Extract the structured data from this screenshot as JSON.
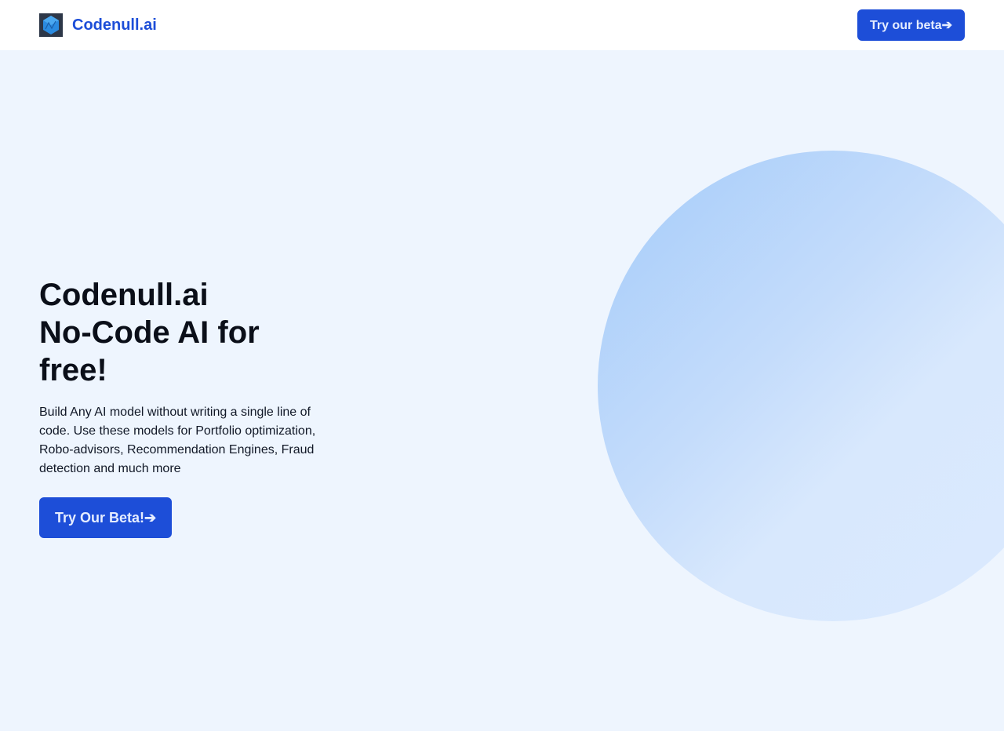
{
  "navbar": {
    "logo_icon": "cube-logo-icon",
    "brand_name": "Codenull.ai",
    "cta_label": "Try our beta➔"
  },
  "hero": {
    "title_lines": [
      "Codenull.ai",
      "No-Code AI for",
      "free!"
    ],
    "description": "Build Any AI model without writing a single line of code. Use these models for Portfolio optimization, Robo-advisors, Recommendation Engines, Fraud detection and much more",
    "cta_label": "Try Our Beta!➔"
  },
  "colors": {
    "accent": "#1d4ed8",
    "hero_background": "#eef5fe",
    "blob_start": "#a4cbfa",
    "blob_end": "#dbeafe"
  }
}
